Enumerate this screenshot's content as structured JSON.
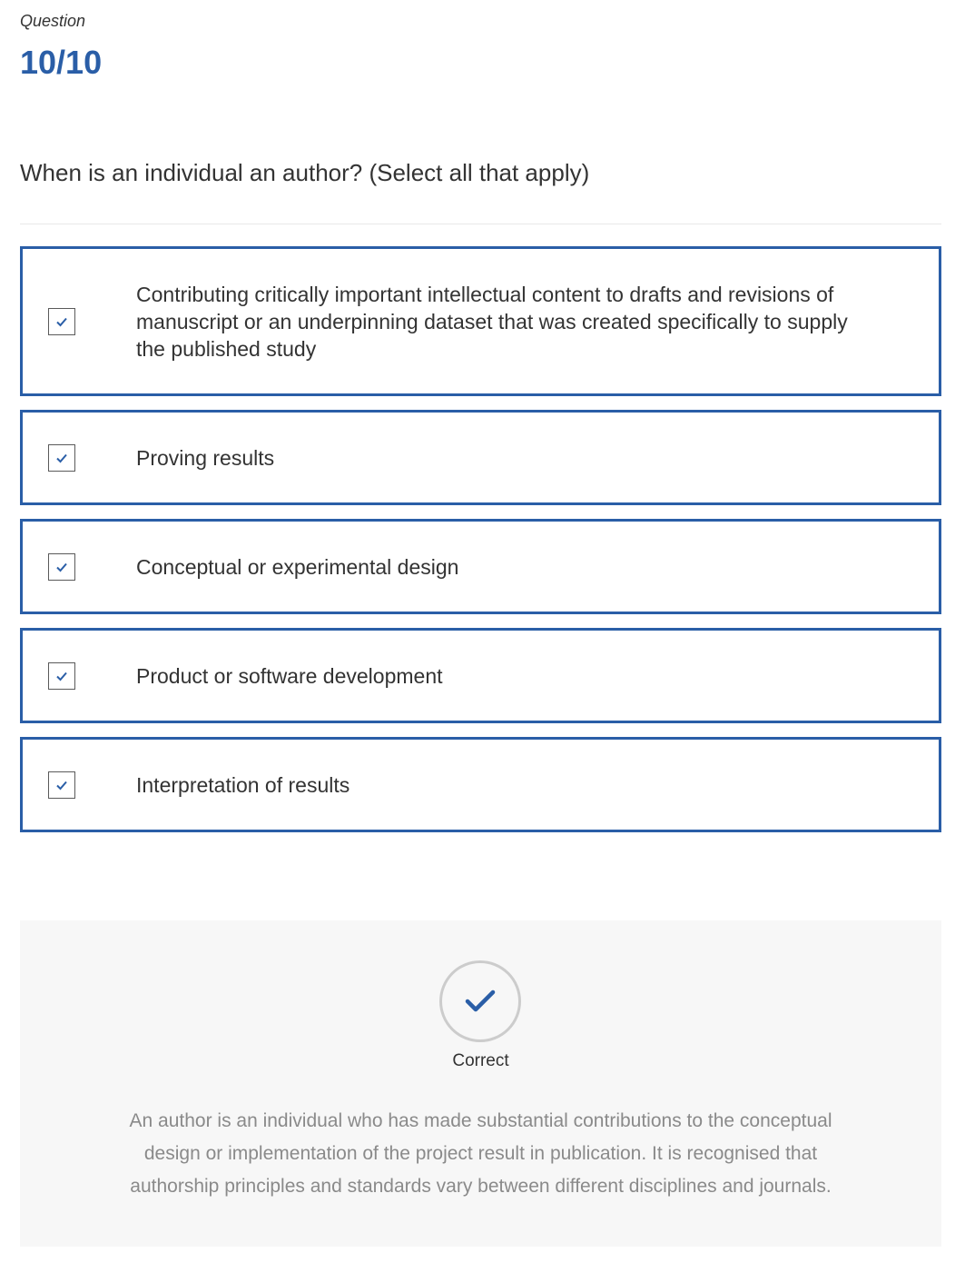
{
  "question": {
    "label": "Question",
    "counter": "10/10",
    "text": "When is an individual an author? (Select all that apply)"
  },
  "options": [
    {
      "text": "Contributing critically important intellectual content to drafts and revisions of manuscript or an underpinning dataset that was created specifically to supply the published study",
      "checked": true
    },
    {
      "text": "Proving results",
      "checked": true
    },
    {
      "text": "Conceptual or experimental design",
      "checked": true
    },
    {
      "text": "Product or software development",
      "checked": true
    },
    {
      "text": "Interpretation of results",
      "checked": true
    }
  ],
  "feedback": {
    "status": "Correct",
    "icon": "checkmark-icon",
    "text": "An author is an individual who has made substantial contributions to the conceptual design or implementation of the project result in publication. It is recognised that authorship principles and standards vary between different disciplines and journals."
  },
  "colors": {
    "accent": "#2a5ea7",
    "feedback_bg": "#f7f7f7",
    "muted_text": "#8a8a8a"
  }
}
